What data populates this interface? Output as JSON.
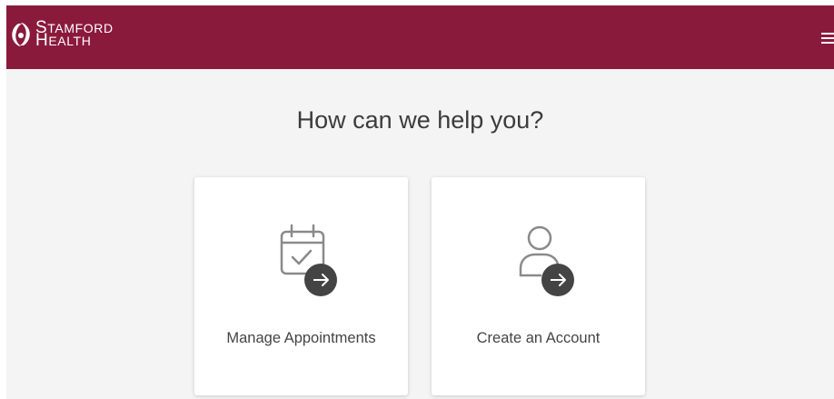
{
  "header": {
    "brand_line1_initial": "S",
    "brand_line1_rest": "TAMFORD",
    "brand_line2_initial": "H",
    "brand_line2_rest": "EALTH",
    "brand_color": "#8a1a3b",
    "menu_icon": "hamburger-menu-icon"
  },
  "main": {
    "title": "How can we help you?",
    "background": "#f4f4f4",
    "cards": [
      {
        "label": "Manage Appointments",
        "icon": "calendar-check-arrow-icon"
      },
      {
        "label": "Create an Account",
        "icon": "user-arrow-icon"
      }
    ]
  }
}
